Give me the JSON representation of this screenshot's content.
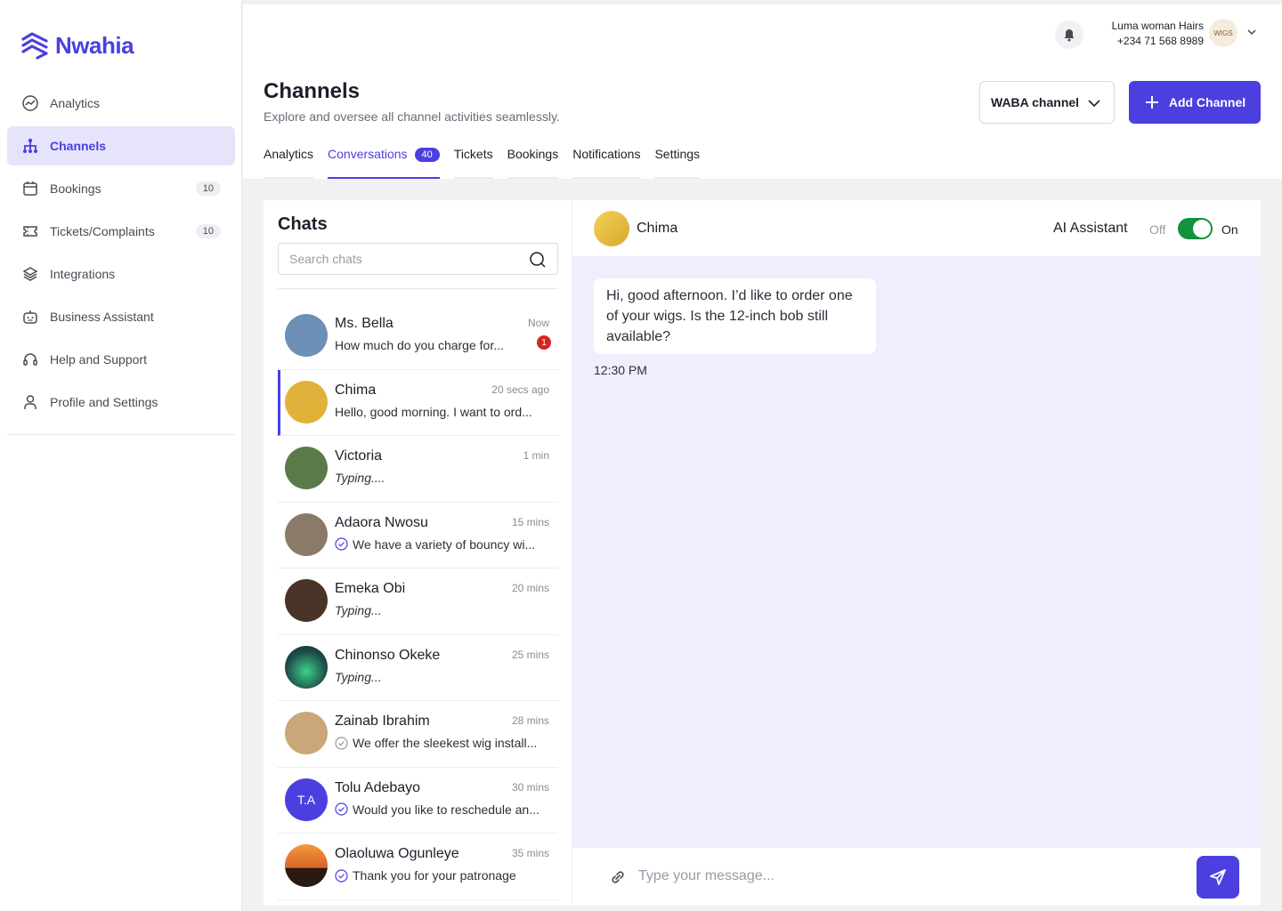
{
  "brand": {
    "name": "Nwahia",
    "color": "#4b3fe0"
  },
  "sidebar": {
    "items": [
      {
        "label": "Analytics",
        "icon": "chart-icon"
      },
      {
        "label": "Channels",
        "icon": "hierarchy-icon",
        "active": true
      },
      {
        "label": "Bookings",
        "icon": "calendar-icon",
        "badge": "10"
      },
      {
        "label": "Tickets/Complaints",
        "icon": "ticket-icon",
        "badge": "10"
      },
      {
        "label": "Integrations",
        "icon": "layers-icon"
      },
      {
        "label": "Business Assistant",
        "icon": "robot-icon"
      },
      {
        "label": "Help and Support",
        "icon": "headset-icon"
      },
      {
        "label": "Profile and Settings",
        "icon": "user-icon"
      }
    ]
  },
  "header": {
    "user_name": "Luma woman Hairs",
    "user_phone": "+234 71 568 8989",
    "avatar_text": "WIGS",
    "title": "Channels",
    "subtitle": "Explore and oversee all channel activities seamlessly.",
    "channel_select": "WABA channel",
    "add_button": "Add Channel"
  },
  "tabs": [
    {
      "label": "Analytics"
    },
    {
      "label": "Conversations",
      "count": "40",
      "active": true
    },
    {
      "label": "Tickets"
    },
    {
      "label": "Bookings"
    },
    {
      "label": "Notifications"
    },
    {
      "label": "Settings"
    }
  ],
  "chats": {
    "title": "Chats",
    "search_placeholder": "Search chats",
    "items": [
      {
        "name": "Ms. Bella",
        "time": "Now",
        "preview": "How much do you charge for...",
        "unread": "1",
        "avatar_color": "#6b8fb5"
      },
      {
        "name": "Chima",
        "time": "20 secs ago",
        "preview": "Hello, good morning. I want to ord...",
        "selected": true,
        "avatar_color": "#e0b23a"
      },
      {
        "name": "Victoria",
        "time": "1 min",
        "preview": "Typing....",
        "italic": true,
        "avatar_color": "#5a7a4a"
      },
      {
        "name": "Adaora Nwosu",
        "time": "15 mins",
        "preview": "We have a variety of bouncy wi...",
        "check": "purple",
        "avatar_color": "#8a7a6a"
      },
      {
        "name": "Emeka Obi",
        "time": "20 mins",
        "preview": "Typing...",
        "italic": true,
        "avatar_color": "#4a3428"
      },
      {
        "name": "Chinonso Okeke",
        "time": "25 mins",
        "preview": "Typing...",
        "italic": true,
        "avatar_color": "#1d4d4a"
      },
      {
        "name": "Zainab Ibrahim",
        "time": "28 mins",
        "preview": "We offer the sleekest wig install...",
        "check": "grey",
        "avatar_color": "#c9a77a"
      },
      {
        "name": "Tolu Adebayo",
        "time": "30 mins",
        "preview": "Would you like to reschedule an...",
        "check": "purple",
        "initials": "T.A",
        "avatar_color": "#4b3fe0"
      },
      {
        "name": "Olaoluwa Ogunleye",
        "time": "35 mins",
        "preview": "Thank you for your patronage",
        "check": "purple",
        "avatar_color": "#d8642a"
      }
    ]
  },
  "conversation": {
    "contact": "Chima",
    "ai_label": "AI Assistant",
    "off_label": "Off",
    "on_label": "On",
    "ai_enabled": true,
    "message": "Hi, good afternoon. I’d like to order one of your wigs. Is the 12-inch bob still available?",
    "message_time": "12:30 PM",
    "compose_placeholder": "Type your message..."
  }
}
